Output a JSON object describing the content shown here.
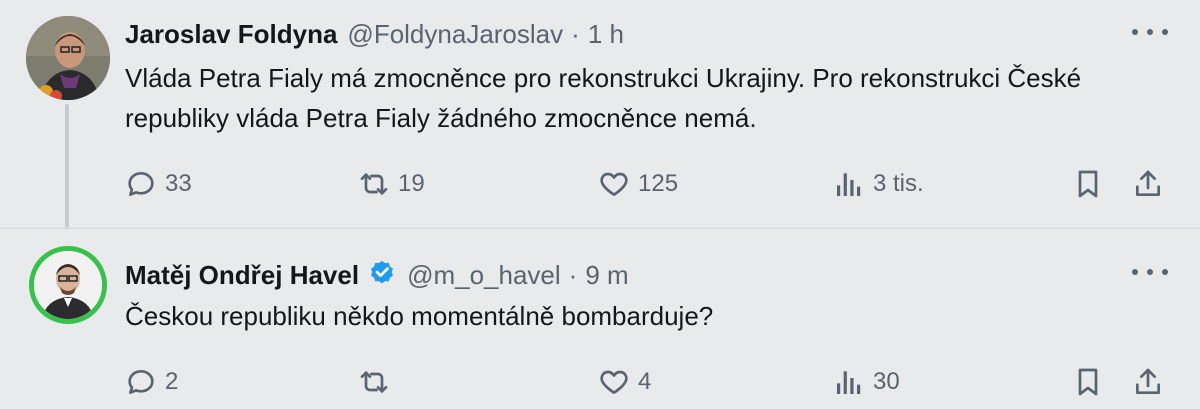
{
  "tweets": [
    {
      "name": "Jaroslav Foldyna",
      "handle": "@FoldynaJaroslav",
      "separator": "·",
      "time": "1 h",
      "verified": false,
      "text": "Vláda Petra Fialy má zmocněnce pro rekonstrukci Ukrajiny. Pro rekonstrukci České republiky vláda Petra Fialy žádného zmocněnce nemá.",
      "stats": {
        "replies": "33",
        "retweets": "19",
        "likes": "125",
        "views": "3 tis."
      }
    },
    {
      "name": "Matěj Ondřej Havel",
      "handle": "@m_o_havel",
      "separator": "·",
      "time": "9 m",
      "verified": true,
      "text": "Českou republiku někdo momentálně bombarduje?",
      "stats": {
        "replies": "2",
        "retweets": "",
        "likes": "4",
        "views": "30"
      }
    }
  ],
  "icons": {
    "reply": "reply-icon",
    "retweet": "retweet-icon",
    "like": "heart-icon",
    "views": "views-icon",
    "bookmark": "bookmark-icon",
    "share": "share-icon",
    "more": "more-icon",
    "verified": "verified-badge-icon"
  },
  "colors": {
    "background": "#e9eaec",
    "muted_text": "#5a6470",
    "verified_blue": "#1d9bf0",
    "avatar_ring": "#37c24b"
  }
}
